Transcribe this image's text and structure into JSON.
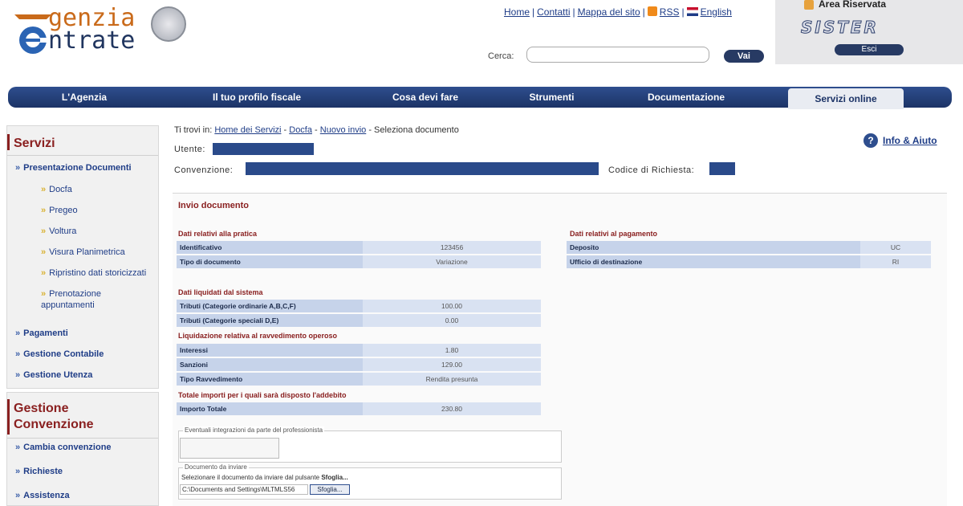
{
  "header": {
    "logo_line1": "genzia",
    "logo_line2": "ntrate",
    "top_links": [
      "Home",
      "Contatti",
      "Mappa del sito",
      "RSS",
      "English"
    ],
    "search_label": "Cerca:",
    "search_placeholder": "",
    "search_button": "Vai"
  },
  "reserved_area": {
    "title": "Area Riservata",
    "brand": "SISTER",
    "exit_button": "Esci"
  },
  "nav": {
    "items": [
      "L'Agenzia",
      "Il tuo profilo fiscale",
      "Cosa devi fare",
      "Strumenti",
      "Documentazione",
      "Servizi online"
    ],
    "active": "Servizi online"
  },
  "sidebar": {
    "services_title": "Servizi",
    "services": [
      {
        "label": "Presentazione Documenti",
        "children": [
          "Docfa",
          "Pregeo",
          "Voltura",
          "Visura Planimetrica",
          "Ripristino dati storicizzati",
          "Prenotazione appuntamenti"
        ]
      },
      {
        "label": "Pagamenti"
      },
      {
        "label": "Gestione Contabile"
      },
      {
        "label": "Gestione Utenza"
      }
    ],
    "convention_title": "Gestione Convenzione",
    "convention_items": [
      "Cambia convenzione",
      "Richieste",
      "Assistenza"
    ]
  },
  "breadcrumb": {
    "prefix": "Ti trovi in:",
    "links": [
      "Home dei Servizi",
      "Docfa",
      "Nuovo invio"
    ],
    "current": "Seleziona documento"
  },
  "info_help": "Info & Aiuto",
  "meta": {
    "user_label": "Utente:",
    "convention_label": "Convenzione:",
    "request_code_label": "Codice di Richiesta:"
  },
  "form": {
    "title": "Invio documento",
    "practice_section": "Dati relativi alla pratica",
    "practice_rows": [
      {
        "k": "Identificativo",
        "v": "123456"
      },
      {
        "k": "Tipo di documento",
        "v": "Variazione"
      }
    ],
    "payment_section": "Dati relativi al pagamento",
    "payment_rows": [
      {
        "k": "Deposito",
        "v": "UC"
      },
      {
        "k": "Ufficio di destinazione",
        "v": "RI"
      }
    ],
    "system_section": "Dati liquidati dal sistema",
    "system_rows": [
      {
        "k": "Tributi (Categorie ordinarie A,B,C,F)",
        "v": "100.00"
      },
      {
        "k": "Tributi (Categorie speciali D,E)",
        "v": "0.00"
      }
    ],
    "ravvedimento_section": "Liquidazione relativa al ravvedimento operoso",
    "ravvedimento_rows": [
      {
        "k": "Interessi",
        "v": "1.80"
      },
      {
        "k": "Sanzioni",
        "v": "129.00"
      },
      {
        "k": "Tipo Ravvedimento",
        "v": "Rendita presunta"
      }
    ],
    "total_section": "Totale importi per i quali sarà disposto l'addebito",
    "total_row": {
      "k": "Importo Totale",
      "v": "230.80"
    },
    "integrations_legend": "Eventuali integrazioni da parte del professionista",
    "document_legend": "Documento da inviare",
    "document_hint_prefix": "Selezionare il documento da inviare dal pulsante",
    "document_hint_bold": "Sfoglia...",
    "file_value": "C:\\Documents and Settings\\MLTMLS56",
    "browse_button": "Sfoglia..."
  },
  "colors": {
    "brand_blue": "#1c3366",
    "accent_red": "#8a2020",
    "row_key": "#c6d3ea",
    "row_value": "#d9e2f2"
  }
}
